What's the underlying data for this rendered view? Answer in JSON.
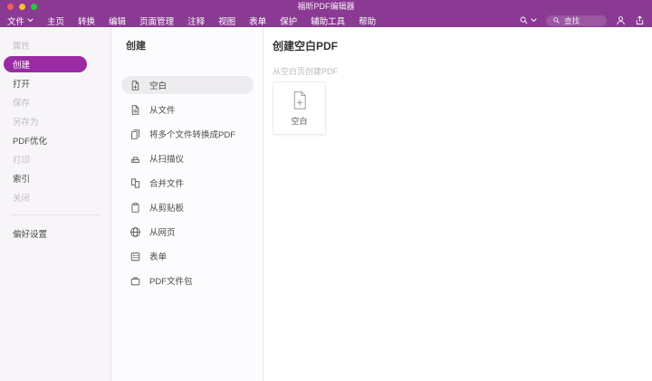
{
  "window": {
    "title": "福昕PDF编辑器"
  },
  "menubar": {
    "items": [
      {
        "label": "文件"
      },
      {
        "label": "主页"
      },
      {
        "label": "转换"
      },
      {
        "label": "编辑"
      },
      {
        "label": "页面管理"
      },
      {
        "label": "注释"
      },
      {
        "label": "视图"
      },
      {
        "label": "表单"
      },
      {
        "label": "保护"
      },
      {
        "label": "辅助工具"
      },
      {
        "label": "帮助"
      }
    ],
    "search": {
      "placeholder": "查找"
    }
  },
  "sidebar": {
    "items": [
      {
        "label": "属性",
        "state": "disabled"
      },
      {
        "label": "创建",
        "state": "selected"
      },
      {
        "label": "打开",
        "state": "normal"
      },
      {
        "label": "保存",
        "state": "disabled"
      },
      {
        "label": "另存为",
        "state": "disabled"
      },
      {
        "label": "PDF优化",
        "state": "normal"
      },
      {
        "label": "打印",
        "state": "disabled"
      },
      {
        "label": "索引",
        "state": "normal"
      },
      {
        "label": "关闭",
        "state": "disabled"
      }
    ],
    "footer": {
      "label": "偏好设置"
    }
  },
  "panel": {
    "title": "创建",
    "items": [
      {
        "label": "空白",
        "icon": "blank-page-plus-icon",
        "selected": true
      },
      {
        "label": "从文件",
        "icon": "file-icon"
      },
      {
        "label": "将多个文件转换成PDF",
        "icon": "multiple-files-icon"
      },
      {
        "label": "从扫描仪",
        "icon": "scanner-icon"
      },
      {
        "label": "合并文件",
        "icon": "combine-files-icon"
      },
      {
        "label": "从剪贴板",
        "icon": "clipboard-icon"
      },
      {
        "label": "从网页",
        "icon": "globe-icon"
      },
      {
        "label": "表单",
        "icon": "form-icon"
      },
      {
        "label": "PDF文件包",
        "icon": "portfolio-icon"
      }
    ]
  },
  "content": {
    "title": "创建空白PDF",
    "subtitle": "从空白页创建PDF",
    "card": {
      "label": "空白",
      "icon": "document-plus-icon"
    }
  },
  "colors": {
    "titlebar": "#8a3a92",
    "accent": "#9a2ba3",
    "sidebar_bg": "#f7f5f8",
    "selected_list_bg": "#edebee",
    "traffic_red": "#f55e56",
    "traffic_yellow": "#fdbc2e",
    "traffic_green": "#2ac840"
  }
}
